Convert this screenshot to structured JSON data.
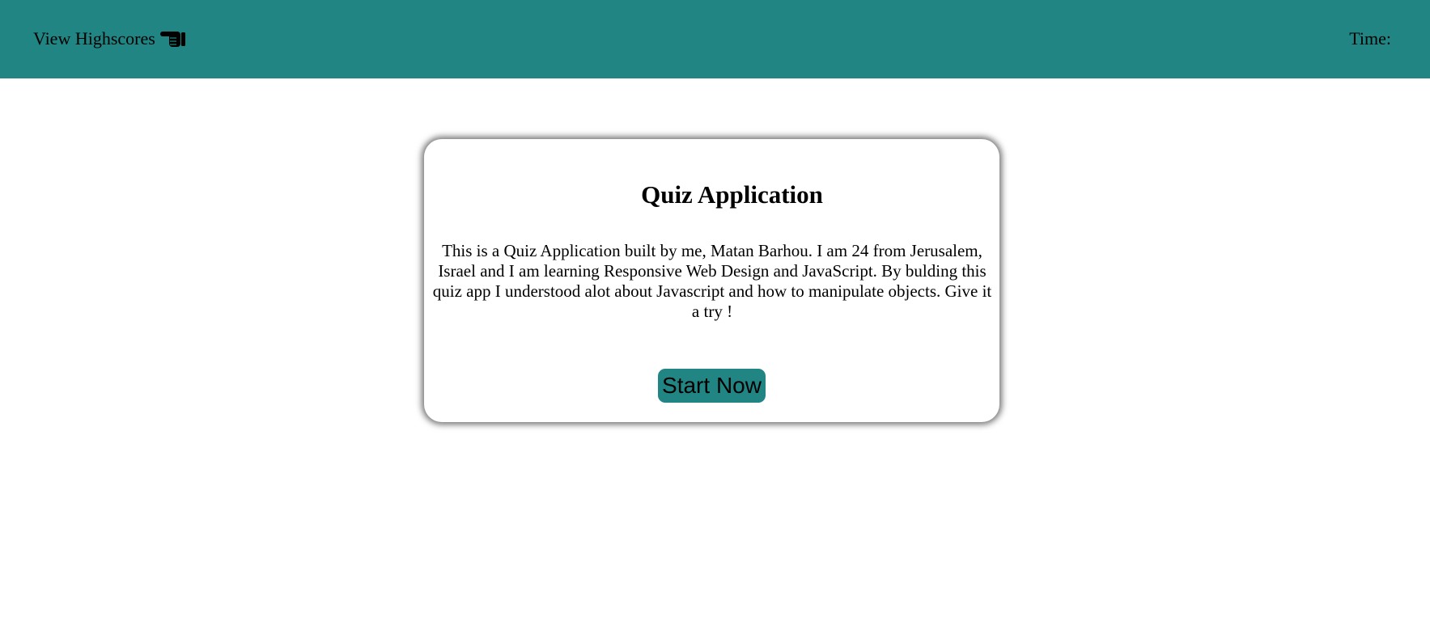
{
  "header": {
    "highscores_label": "View Highscores",
    "highscores_icon": "pointing-hand-icon",
    "timer_label": "Time:",
    "background_color": "#218583"
  },
  "card": {
    "title": "Quiz Application",
    "description": "This is a Quiz Application built by me, Matan Barhou. I am 24 from Jerusalem, Israel and I am learning Responsive Web Design and JavaScript. By bulding this quiz app I understood alot about Javascript and how to manipulate objects. Give it a try !",
    "start_label": "Start Now",
    "accent_color": "#218583"
  }
}
